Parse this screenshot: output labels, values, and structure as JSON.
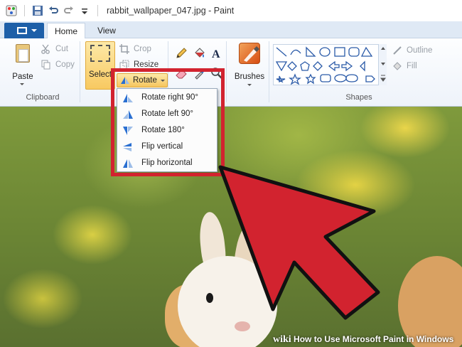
{
  "window": {
    "title": "rabbit_wallpaper_047.jpg - Paint"
  },
  "tabs": {
    "home": "Home",
    "view": "View"
  },
  "ribbon": {
    "clipboard": {
      "paste": "Paste",
      "cut": "Cut",
      "copy": "Copy",
      "group_label": "Clipboard"
    },
    "image": {
      "select": "Select",
      "crop": "Crop",
      "resize": "Resize",
      "rotate": "Rotate"
    },
    "brushes": "Brushes",
    "shapes": {
      "outline": "Outline",
      "fill": "Fill",
      "group_label": "Shapes"
    }
  },
  "rotate_menu": {
    "items": [
      {
        "label": "Rotate right 90°"
      },
      {
        "label": "Rotate left 90°"
      },
      {
        "label": "Rotate 180°"
      },
      {
        "label": "Flip vertical"
      },
      {
        "label": "Flip horizontal"
      }
    ]
  },
  "watermark": {
    "brand": "wiki",
    "text": "How to Use Microsoft Paint in Windows"
  },
  "colors": {
    "ribbon_accent": "#1d5fa8",
    "highlight_red": "#d2232f",
    "selected_button": "#f6c55e"
  }
}
